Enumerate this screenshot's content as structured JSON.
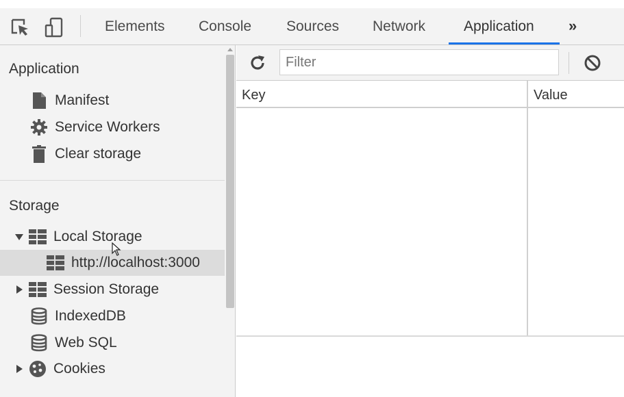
{
  "toolbar": {
    "tabs": [
      {
        "label": "Elements"
      },
      {
        "label": "Console"
      },
      {
        "label": "Sources"
      },
      {
        "label": "Network"
      },
      {
        "label": "Application"
      }
    ],
    "more_label": "»",
    "active_tab": "Application",
    "accent_color": "#1a73e8"
  },
  "sidebar": {
    "application_section": {
      "title": "Application",
      "items": [
        {
          "label": "Manifest",
          "icon": "document-icon"
        },
        {
          "label": "Service Workers",
          "icon": "gear-icon"
        },
        {
          "label": "Clear storage",
          "icon": "trash-icon"
        }
      ]
    },
    "storage_section": {
      "title": "Storage",
      "items": [
        {
          "label": "Local Storage",
          "icon": "table-icon",
          "expanded": true
        },
        {
          "label": "http://localhost:3000",
          "icon": "table-icon",
          "selected": true
        },
        {
          "label": "Session Storage",
          "icon": "table-icon",
          "expanded": false
        },
        {
          "label": "IndexedDB",
          "icon": "database-icon"
        },
        {
          "label": "Web SQL",
          "icon": "database-icon"
        },
        {
          "label": "Cookies",
          "icon": "cookie-icon",
          "expanded": false
        }
      ]
    }
  },
  "main": {
    "filter": {
      "placeholder": "Filter",
      "value": ""
    },
    "columns": [
      {
        "label": "Key"
      },
      {
        "label": "Value"
      }
    ]
  }
}
